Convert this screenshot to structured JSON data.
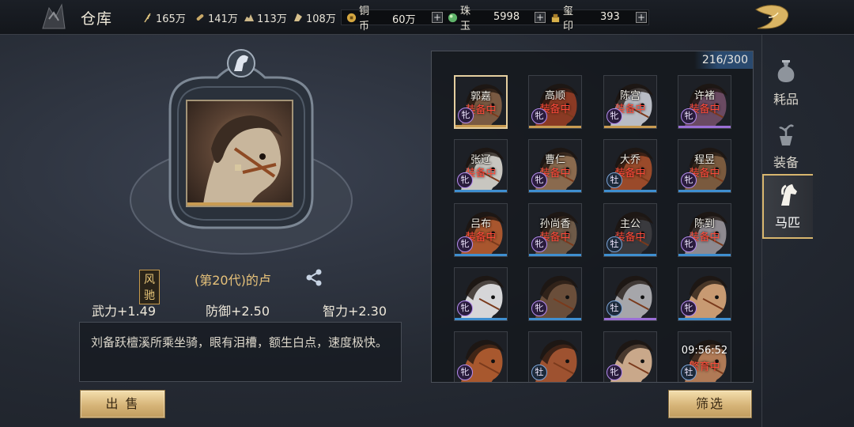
{
  "header": {
    "title": "仓库",
    "resources": [
      {
        "icon": "wheat-icon",
        "value": "165万"
      },
      {
        "icon": "wood-icon",
        "value": "141万"
      },
      {
        "icon": "stone-icon",
        "value": "113万"
      },
      {
        "icon": "iron-icon",
        "value": "108万"
      }
    ],
    "currencies": [
      {
        "icon": "copper-coin-icon",
        "label": "铜币",
        "value": "60万"
      },
      {
        "icon": "jade-icon",
        "label": "珠玉",
        "value": "5998"
      },
      {
        "icon": "seal-icon",
        "label": "玺印",
        "value": "393"
      }
    ],
    "plus": "+"
  },
  "detail": {
    "grade": "风驰",
    "name": "(第20代)的卢",
    "stats": {
      "force": "武力+1.49",
      "defense": "防御+2.50",
      "intellect": "智力+2.30"
    },
    "description": "刘备跃檀溪所乘坐骑，眼有泪槽，额生白点，速度极快。",
    "sell_label": "出 售"
  },
  "grid": {
    "capacity": "216/300",
    "filter_label": "筛选",
    "horses": [
      {
        "owner": "郭嘉",
        "status": "装备中",
        "gender": "牝",
        "coat": "#7a5a42",
        "bar": "#c89b52",
        "selected": true
      },
      {
        "owner": "高顺",
        "status": "装备中",
        "gender": "牝",
        "coat": "#8a3a24",
        "bar": "#c89b52"
      },
      {
        "owner": "陈宫",
        "status": "装备中",
        "gender": "牝",
        "coat": "#b9bcc4",
        "bar": "#c89b52"
      },
      {
        "owner": "许褚",
        "status": "装备中",
        "gender": "牝",
        "coat": "#6a4a62",
        "bar": "#9b6fd6"
      },
      {
        "owner": "张辽",
        "status": "装备中",
        "gender": "牝",
        "coat": "#c8c6c0",
        "bar": "#3f8fd0"
      },
      {
        "owner": "曹仁",
        "status": "装备中",
        "gender": "牝",
        "coat": "#8a6a4e",
        "bar": "#3f8fd0"
      },
      {
        "owner": "大乔",
        "status": "装备中",
        "gender": "牡",
        "coat": "#9a4a2a",
        "bar": "#3f8fd0"
      },
      {
        "owner": "程昱",
        "status": "装备中",
        "gender": "牝",
        "coat": "#7a5a3e",
        "bar": "#3f8fd0"
      },
      {
        "owner": "吕布",
        "status": "装备中",
        "gender": "牝",
        "coat": "#a8562e",
        "bar": "#3f8fd0"
      },
      {
        "owner": "孙尚香",
        "status": "装备中",
        "gender": "牝",
        "coat": "#6e5a48",
        "bar": "#3f8fd0"
      },
      {
        "owner": "主公",
        "status": "装备中",
        "gender": "牡",
        "coat": "#3a3a3e",
        "bar": "#3f8fd0"
      },
      {
        "owner": "陈到",
        "status": "装备中",
        "gender": "牝",
        "coat": "#8e8a90",
        "bar": "#3f8fd0"
      },
      {
        "owner": "",
        "status": "",
        "gender": "牝",
        "coat": "#d6d6d8",
        "bar": "#3f8fd0"
      },
      {
        "owner": "",
        "status": "",
        "gender": "牝",
        "coat": "#6a4e3a",
        "bar": "#3f8fd0"
      },
      {
        "owner": "",
        "status": "",
        "gender": "牡",
        "coat": "#a6a6aa",
        "bar": "#9b6fd6"
      },
      {
        "owner": "",
        "status": "",
        "gender": "牝",
        "coat": "#c89a72",
        "bar": "#3f8fd0"
      },
      {
        "owner": "",
        "status": "",
        "gender": "牝",
        "coat": "#a8582e",
        "bar": ""
      },
      {
        "owner": "",
        "status": "",
        "gender": "牡",
        "coat": "#9e5230",
        "bar": ""
      },
      {
        "owner": "",
        "status": "",
        "gender": "牝",
        "coat": "#c9a88a",
        "bar": ""
      },
      {
        "owner": "",
        "status": "繁育中",
        "gender": "牡",
        "coat": "#b07a56",
        "bar": "",
        "timer": "09:56:52"
      }
    ]
  },
  "tabs": [
    {
      "label": "耗品",
      "icon": "potion-bag-icon",
      "active": false
    },
    {
      "label": "装备",
      "icon": "plant-pot-icon",
      "active": false
    },
    {
      "label": "马匹",
      "icon": "horse-head-icon",
      "active": true
    }
  ]
}
